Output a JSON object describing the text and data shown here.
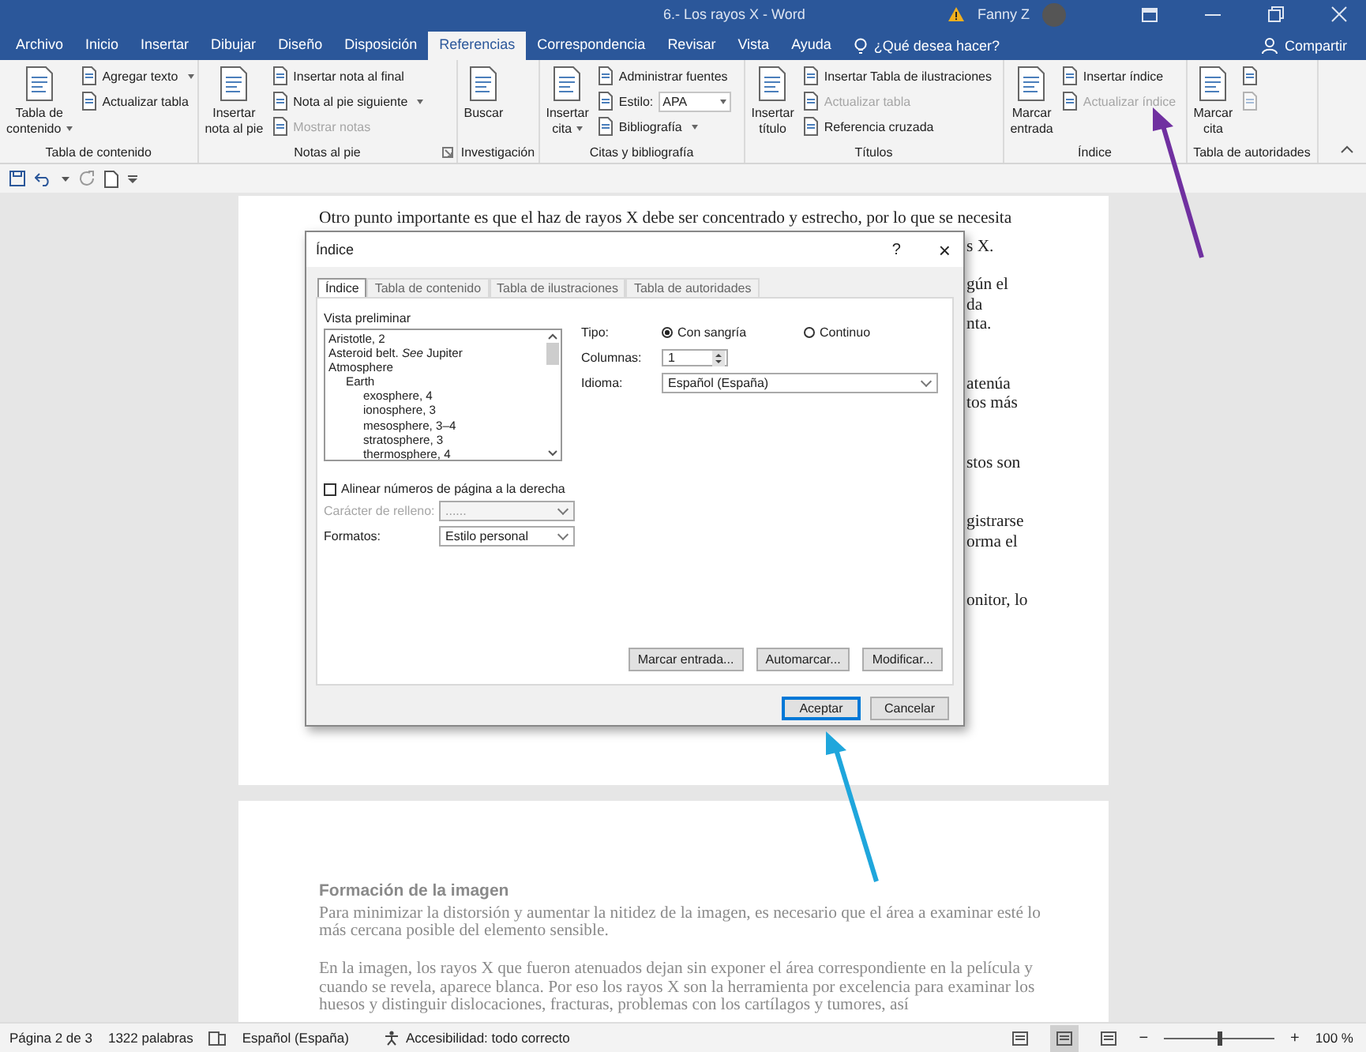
{
  "window": {
    "title": "6.- Los rayos X  -  Word",
    "user": "Fanny Z"
  },
  "tabs": [
    {
      "label": "Archivo",
      "selected": false
    },
    {
      "label": "Inicio",
      "selected": false
    },
    {
      "label": "Insertar",
      "selected": false
    },
    {
      "label": "Dibujar",
      "selected": false
    },
    {
      "label": "Diseño",
      "selected": false
    },
    {
      "label": "Disposición",
      "selected": false
    },
    {
      "label": "Referencias",
      "selected": true
    },
    {
      "label": "Correspondencia",
      "selected": false
    },
    {
      "label": "Revisar",
      "selected": false
    },
    {
      "label": "Vista",
      "selected": false
    },
    {
      "label": "Ayuda",
      "selected": false
    }
  ],
  "tell_me": {
    "placeholder": "¿Qué desea hacer?"
  },
  "share": {
    "label": "Compartir"
  },
  "ribbon": {
    "groups": [
      {
        "label": "Tabla de contenido",
        "launcher": false,
        "columns": [
          [
            {
              "kind": "large",
              "lines": [
                "Tabla de",
                "contenido"
              ],
              "dropdown": true,
              "disabled": false
            }
          ],
          [
            {
              "kind": "small",
              "label": "Agregar texto",
              "dropdown": true,
              "disabled": false
            },
            {
              "kind": "small",
              "label": "Actualizar tabla",
              "dropdown": false,
              "disabled": false
            }
          ]
        ]
      },
      {
        "label": "Notas al pie",
        "launcher": true,
        "columns": [
          [
            {
              "kind": "large",
              "lines": [
                "Insertar",
                "nota al pie"
              ],
              "dropdown": false,
              "disabled": false
            }
          ],
          [
            {
              "kind": "small",
              "label": "Insertar nota al final",
              "dropdown": false,
              "disabled": false
            },
            {
              "kind": "small",
              "label": "Nota al pie siguiente",
              "dropdown": true,
              "disabled": false
            },
            {
              "kind": "small",
              "label": "Mostrar notas",
              "dropdown": false,
              "disabled": true
            }
          ]
        ]
      },
      {
        "label": "Investigación",
        "launcher": false,
        "columns": [
          [
            {
              "kind": "large",
              "lines": [
                "Buscar"
              ],
              "dropdown": false,
              "disabled": false
            }
          ]
        ]
      },
      {
        "label": "Citas y bibliografía",
        "launcher": false,
        "columns": [
          [
            {
              "kind": "large",
              "lines": [
                "Insertar",
                "cita"
              ],
              "dropdown": true,
              "disabled": false
            }
          ],
          [
            {
              "kind": "small",
              "label": "Administrar fuentes",
              "dropdown": false,
              "disabled": false
            },
            {
              "kind": "combo",
              "label": "Estilo:",
              "value": "APA",
              "dropdown": true,
              "disabled": false
            },
            {
              "kind": "small",
              "label": "Bibliografía",
              "dropdown": true,
              "disabled": false
            }
          ]
        ]
      },
      {
        "label": "Títulos",
        "launcher": false,
        "columns": [
          [
            {
              "kind": "large",
              "lines": [
                "Insertar",
                "título"
              ],
              "dropdown": false,
              "disabled": false
            }
          ],
          [
            {
              "kind": "small",
              "label": "Insertar Tabla de ilustraciones",
              "dropdown": false,
              "disabled": false
            },
            {
              "kind": "small",
              "label": "Actualizar tabla",
              "dropdown": false,
              "disabled": true
            },
            {
              "kind": "small",
              "label": "Referencia cruzada",
              "dropdown": false,
              "disabled": false
            }
          ]
        ]
      },
      {
        "label": "Índice",
        "launcher": false,
        "columns": [
          [
            {
              "kind": "large",
              "lines": [
                "Marcar",
                "entrada"
              ],
              "dropdown": false,
              "disabled": false
            }
          ],
          [
            {
              "kind": "small",
              "label": "Insertar índice",
              "dropdown": false,
              "disabled": false
            },
            {
              "kind": "small",
              "label": "Actualizar índice",
              "dropdown": false,
              "disabled": true
            }
          ]
        ]
      },
      {
        "label": "Tabla de autoridades",
        "launcher": false,
        "columns": [
          [
            {
              "kind": "large",
              "lines": [
                "Marcar",
                "cita"
              ],
              "dropdown": false,
              "disabled": false
            }
          ],
          [
            {
              "kind": "icon",
              "dropdown": false,
              "disabled": false
            },
            {
              "kind": "icon",
              "dropdown": false,
              "disabled": true
            }
          ]
        ]
      }
    ]
  },
  "document": {
    "page1": {
      "first_line": "Otro punto importante es que el haz de rayos X debe ser concentrado y estrecho, por lo que se necesita",
      "fragments": [
        [
          "s X."
        ],
        [
          "gún el",
          "da",
          "nta."
        ],
        [
          "atenúa",
          "tos más"
        ],
        [
          "stos son"
        ],
        [
          "gistrarse",
          "orma el"
        ],
        [
          "onitor, lo"
        ]
      ]
    },
    "page2": {
      "heading": "Formación de la imagen",
      "paragraphs": [
        "Para minimizar la distorsión y aumentar la nitidez de la imagen, es necesario que el área a examinar esté lo más cercana posible del elemento sensible.",
        "En la imagen, los rayos X que fueron atenuados dejan sin exponer el área correspondiente en la película y cuando se revela, aparece blanca. Por eso los rayos X son la herramienta por excelencia para examinar los huesos y distinguir dislocaciones, fracturas, problemas con los cartílagos y tumores, así"
      ]
    }
  },
  "dialog": {
    "title": "Índice",
    "help": "?",
    "close": "×",
    "tabs": [
      {
        "label": "Índice",
        "selected": true
      },
      {
        "label": "Tabla de contenido",
        "selected": false
      },
      {
        "label": "Tabla de ilustraciones",
        "selected": false
      },
      {
        "label": "Tabla de autoridades",
        "selected": false
      }
    ],
    "preview": {
      "label": "Vista preliminar",
      "entries": [
        {
          "text": "Aristotle, 2"
        },
        {
          "text": "Asteroid belt. *See* Jupiter"
        },
        {
          "text": "Atmosphere",
          "children": [
            {
              "text": "Earth",
              "children": [
                {
                  "text": "exosphere, 4"
                },
                {
                  "text": "ionosphere, 3"
                },
                {
                  "text": "mesosphere, 3–4"
                },
                {
                  "text": "stratosphere, 3"
                },
                {
                  "text": "thermosphere, 4"
                }
              ]
            }
          ]
        }
      ]
    },
    "type": {
      "label": "Tipo:",
      "options": [
        {
          "label": "Con sangría",
          "selected": true
        },
        {
          "label": "Continuo",
          "selected": false
        }
      ]
    },
    "columns": {
      "label": "Columnas:",
      "value": "1"
    },
    "language": {
      "label": "Idioma:",
      "value": "Español (España)"
    },
    "align_right": {
      "label": "Alinear números de página a la derecha",
      "checked": false
    },
    "fill_char": {
      "label": "Carácter de relleno:",
      "value": "......",
      "disabled": true
    },
    "formats": {
      "label": "Formatos:",
      "value": "Estilo personal",
      "disabled": false
    },
    "actions": [
      "Marcar entrada...",
      "Automarcar...",
      "Modificar..."
    ],
    "buttons": [
      {
        "label": "Aceptar",
        "default": true
      },
      {
        "label": "Cancelar",
        "default": false
      }
    ]
  },
  "status_bar": {
    "page": "Página 2 de 3",
    "words": "1322 palabras",
    "language": "Español (España)",
    "accessibility": "Accesibilidad: todo correcto",
    "views": [
      {
        "selected": false
      },
      {
        "selected": true
      },
      {
        "selected": false
      }
    ],
    "zoom_out": "−",
    "zoom_in": "+",
    "zoom": {
      "level": 0.5
    },
    "zoom_label": "100 %"
  }
}
